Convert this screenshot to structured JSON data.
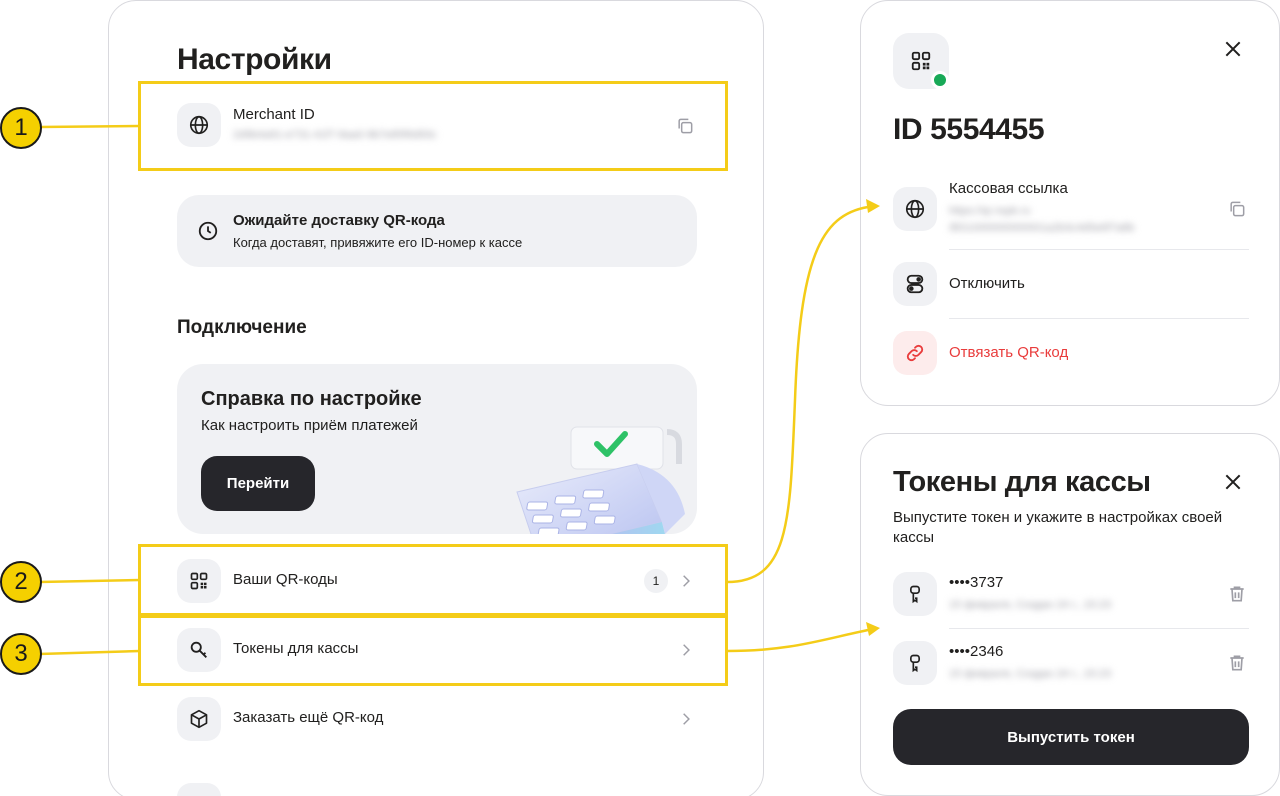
{
  "settings": {
    "title": "Настройки",
    "merchant_label": "Merchant ID",
    "merchant_value": "2d9b4a91-e731-41f7-8aa0-9b7e85f6d93c",
    "delivery_title": "Ожидайте доставку QR-кода",
    "delivery_sub": "Когда доставят, привяжите его ID-номер к кассе",
    "section_title": "Подключение",
    "help_title": "Справка по настройке",
    "help_sub": "Как настроить приём платежей",
    "help_button": "Перейти",
    "rows": [
      {
        "label": "Ваши QR-коды",
        "count": "1"
      },
      {
        "label": "Токены для кассы"
      },
      {
        "label": "Заказать ещё QR-код"
      }
    ]
  },
  "qr_panel": {
    "title": "ID 5554455",
    "link_label": "Кассовая ссылка",
    "link_value_1": "https://qr.nspk.ru",
    "link_value_2": "/BS1000000000001a2b3c4d5e6f7a8b",
    "disable_label": "Отключить",
    "unbind_label": "Отвязать QR-код"
  },
  "tokens_panel": {
    "title": "Токены для кассы",
    "subtitle_1": "Выпустите токен и укажите в настройках своей",
    "subtitle_2": "кассы",
    "tokens": [
      {
        "name": "••••3737",
        "meta": "15 февраля, Создан 24 г., 15:23"
      },
      {
        "name": "••••2346",
        "meta": "15 февраля, Создан 24 г., 15:23"
      }
    ],
    "issue_button": "Выпустить токен"
  },
  "callouts": [
    "1",
    "2",
    "3"
  ],
  "colors": {
    "highlight": "#f4cc18",
    "danger": "#e93c3c",
    "status_online": "#18a957",
    "dark_button": "#26262b"
  }
}
